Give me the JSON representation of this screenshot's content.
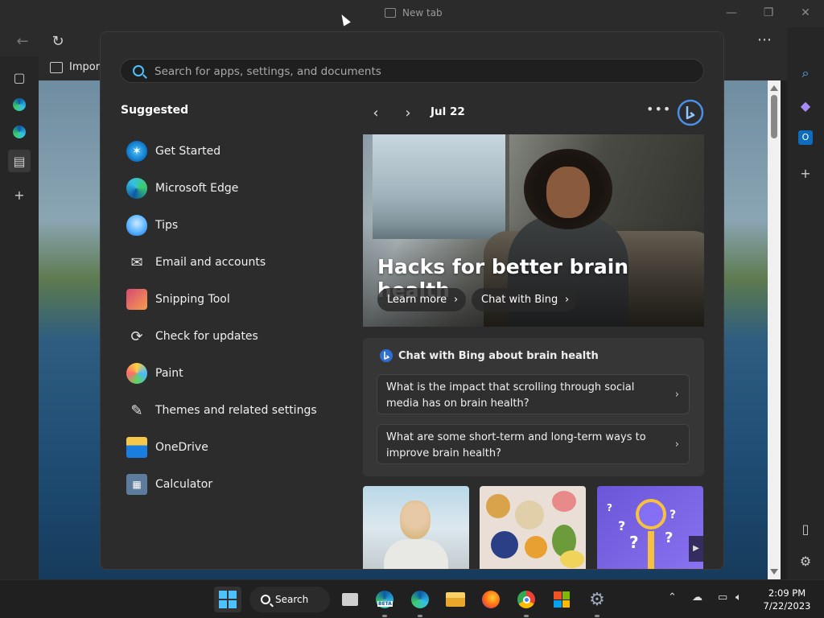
{
  "browser": {
    "tab_title": "New tab",
    "favorites": {
      "import_label": "Import"
    },
    "icons": [
      "back-icon",
      "refresh-icon",
      "more-icon",
      "bing-icon"
    ]
  },
  "start_menu": {
    "search": {
      "placeholder": "Search for apps, settings, and documents",
      "value": ""
    },
    "suggested": {
      "title": "Suggested",
      "items": [
        {
          "label": "Get Started",
          "icon": "get-started-icon"
        },
        {
          "label": "Microsoft Edge",
          "icon": "edge-icon"
        },
        {
          "label": "Tips",
          "icon": "tips-icon"
        },
        {
          "label": "Email and accounts",
          "icon": "mail-icon"
        },
        {
          "label": "Snipping Tool",
          "icon": "snipping-tool-icon"
        },
        {
          "label": "Check for updates",
          "icon": "update-icon"
        },
        {
          "label": "Paint",
          "icon": "paint-icon"
        },
        {
          "label": "Themes and related settings",
          "icon": "brush-icon"
        },
        {
          "label": "OneDrive",
          "icon": "onedrive-icon"
        },
        {
          "label": "Calculator",
          "icon": "calculator-icon"
        }
      ]
    },
    "feed": {
      "date": "Jul 22",
      "hero": {
        "title": "Hacks for better brain health",
        "learn_more": "Learn more",
        "chat_with_bing": "Chat with Bing"
      },
      "chat_card": {
        "heading": "Chat with Bing about brain health",
        "questions": [
          "What is the impact that scrolling through social media has on brain health?",
          "What are some short-term and long-term ways to improve brain health?"
        ]
      }
    }
  },
  "taskbar": {
    "search_label": "Search",
    "clock": {
      "time": "2:09 PM",
      "date": "7/22/2023"
    },
    "edge_beta_badge": "BETA"
  },
  "colors": {
    "accent": "#4cc2ff",
    "menu_bg": "#2c2c2c",
    "taskbar_bg": "#202020"
  }
}
